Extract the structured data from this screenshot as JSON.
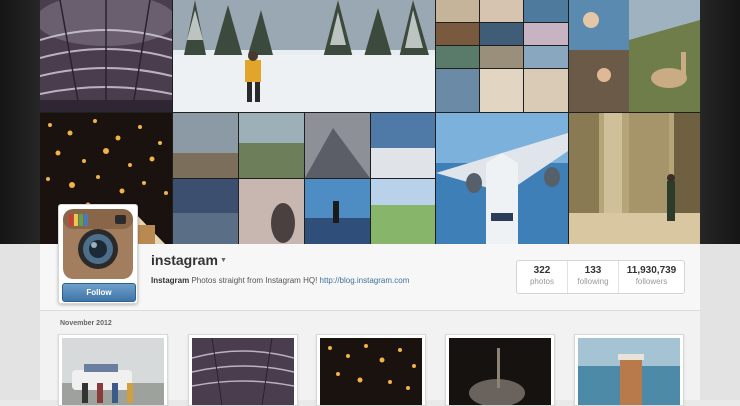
{
  "profile": {
    "username": "instagram",
    "name": "Instagram",
    "bio_text": "Photos straight from Instagram HQ!",
    "link": "http://blog.instagram.com",
    "follow_label": "Follow"
  },
  "stats": [
    {
      "value": "322",
      "label": "photos"
    },
    {
      "value": "133",
      "label": "following"
    },
    {
      "value": "11,930,739",
      "label": "followers"
    }
  ],
  "feed": {
    "month_label": "November 2012"
  }
}
